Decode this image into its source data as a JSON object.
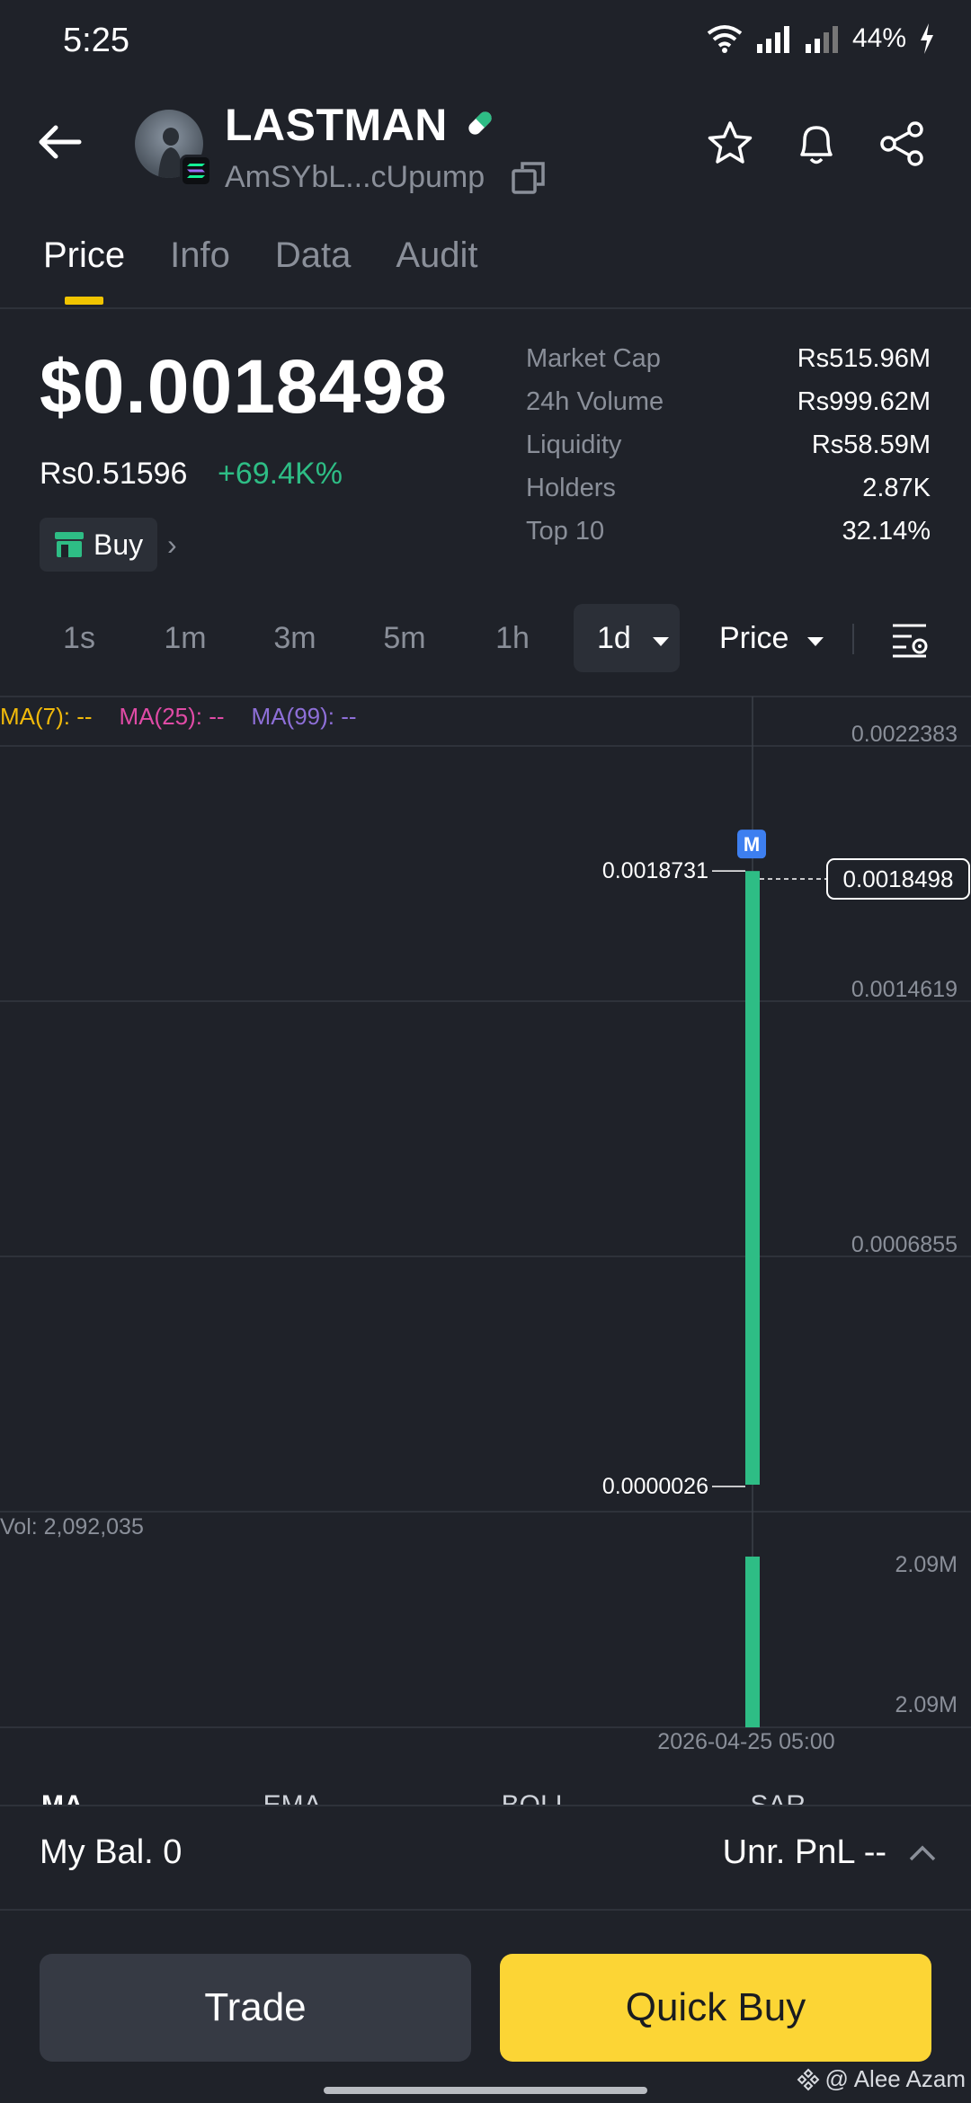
{
  "status": {
    "time": "5:25",
    "battery": "44%"
  },
  "token": {
    "name": "LASTMAN",
    "address": "AmSYbL...cUpump"
  },
  "tabs": [
    {
      "label": "Price"
    },
    {
      "label": "Info"
    },
    {
      "label": "Data"
    },
    {
      "label": "Audit"
    }
  ],
  "price": {
    "usd": "$0.0018498",
    "local": "Rs0.51596",
    "change": "+69.4K%"
  },
  "buy_label": "Buy",
  "stats": [
    {
      "label": "Market Cap",
      "value": "Rs515.96M"
    },
    {
      "label": "24h Volume",
      "value": "Rs999.62M"
    },
    {
      "label": "Liquidity",
      "value": "Rs58.59M"
    },
    {
      "label": "Holders",
      "value": "2.87K"
    },
    {
      "label": "Top 10",
      "value": "32.14%"
    }
  ],
  "intervals": [
    "1s",
    "1m",
    "3m",
    "5m",
    "1h",
    "1d"
  ],
  "price_dropdown": "Price",
  "ma_legend": [
    "MA(7): --",
    "MA(25): --",
    "MA(99): --"
  ],
  "chart": {
    "y_ticks": [
      "0.0022383",
      "0.0014619",
      "0.0006855"
    ],
    "high_label": "0.0018731",
    "low_label": "0.0000026",
    "current_label": "0.0018498",
    "marker": "M",
    "vol_label": "Vol: 2,092,035",
    "vol_ticks": [
      "2.09M",
      "2.09M"
    ],
    "x_label": "2026-04-25 05:00",
    "colors": {
      "up": "#2ebd85",
      "grid": "#2e323a"
    }
  },
  "chart_data": {
    "type": "candlestick",
    "x": [
      "2026-04-25 05:00"
    ],
    "high": [
      0.0018731
    ],
    "low": [
      2.6e-06
    ],
    "close": [
      0.0018498
    ],
    "volume": [
      2092035
    ],
    "ylim": [
      2.6e-06,
      0.0022383
    ]
  },
  "indicator_tabs": [
    "MA",
    "EMA",
    "BOLL",
    "SAR"
  ],
  "balance": {
    "label": "My Bal.",
    "value": "0",
    "pnl_label": "Unr. PnL",
    "pnl_value": "--"
  },
  "buttons": {
    "trade": "Trade",
    "quick_buy": "Quick Buy"
  },
  "watermark": "@ Alee Azam"
}
